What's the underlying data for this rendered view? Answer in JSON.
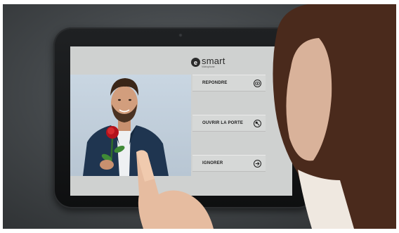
{
  "brand": {
    "name": "smart",
    "sub": "Vidéophone",
    "mark": "e"
  },
  "actions": [
    {
      "label": "REPONDRE",
      "icon": "eye-icon"
    },
    {
      "label": "OUVRIR LA PORTE",
      "icon": "key-icon"
    },
    {
      "label": "IGNORER",
      "icon": "arrow-right-icon"
    }
  ]
}
